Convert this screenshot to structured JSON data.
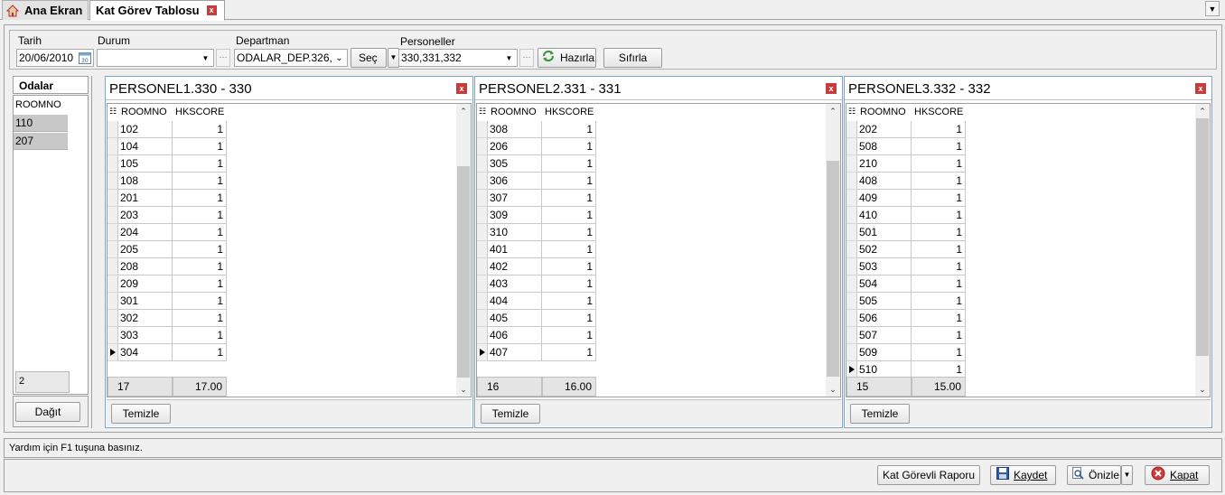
{
  "tabs": {
    "home_label": "Ana Ekran",
    "active_label": "Kat Görev Tablosu",
    "close_glyph": "x",
    "dropdown_glyph": "▼"
  },
  "filters": {
    "tarih_label": "Tarih",
    "tarih_value": "20/06/2010",
    "durum_label": "Durum",
    "durum_value": "",
    "departman_label": "Departman",
    "departman_value": "ODALAR_DEP.326,",
    "sec_button": "Seç",
    "personeller_label": "Personeller",
    "personeller_value": "330,331,332",
    "hazirla_button": "Hazırla",
    "sifirla_button": "Sıfırla",
    "ellipsis": "···"
  },
  "odalar": {
    "title": "Odalar",
    "column": "ROOMNO",
    "rows": [
      "110",
      "207"
    ],
    "count": "2",
    "dagit_button": "Dağıt"
  },
  "personel_panels": [
    {
      "title": "PERSONEL1.330 - 330",
      "col1": "ROOMNO",
      "col2": "HKSCORE",
      "rows": [
        [
          "102",
          "1"
        ],
        [
          "104",
          "1"
        ],
        [
          "105",
          "1"
        ],
        [
          "108",
          "1"
        ],
        [
          "201",
          "1"
        ],
        [
          "203",
          "1"
        ],
        [
          "204",
          "1"
        ],
        [
          "205",
          "1"
        ],
        [
          "208",
          "1"
        ],
        [
          "209",
          "1"
        ],
        [
          "301",
          "1"
        ],
        [
          "302",
          "1"
        ],
        [
          "303",
          "1"
        ],
        [
          "304",
          "1"
        ]
      ],
      "current_row": 13,
      "footer_count": "17",
      "footer_sum": "17.00",
      "scroll_thumb_top_fraction": 0.18,
      "scroll_thumb_size_fraction": 0.8,
      "temizle_button": "Temizle"
    },
    {
      "title": "PERSONEL2.331 - 331",
      "col1": "ROOMNO",
      "col2": "HKSCORE",
      "rows": [
        [
          "308",
          "1"
        ],
        [
          "206",
          "1"
        ],
        [
          "305",
          "1"
        ],
        [
          "306",
          "1"
        ],
        [
          "307",
          "1"
        ],
        [
          "309",
          "1"
        ],
        [
          "310",
          "1"
        ],
        [
          "401",
          "1"
        ],
        [
          "402",
          "1"
        ],
        [
          "403",
          "1"
        ],
        [
          "404",
          "1"
        ],
        [
          "405",
          "1"
        ],
        [
          "406",
          "1"
        ],
        [
          "407",
          "1"
        ]
      ],
      "current_row": 13,
      "footer_count": "16",
      "footer_sum": "16.00",
      "scroll_thumb_top_fraction": 0.16,
      "scroll_thumb_size_fraction": 0.82,
      "temizle_button": "Temizle"
    },
    {
      "title": "PERSONEL3.332 - 332",
      "col1": "ROOMNO",
      "col2": "HKSCORE",
      "rows": [
        [
          "202",
          "1"
        ],
        [
          "508",
          "1"
        ],
        [
          "210",
          "1"
        ],
        [
          "408",
          "1"
        ],
        [
          "409",
          "1"
        ],
        [
          "410",
          "1"
        ],
        [
          "501",
          "1"
        ],
        [
          "502",
          "1"
        ],
        [
          "503",
          "1"
        ],
        [
          "504",
          "1"
        ],
        [
          "505",
          "1"
        ],
        [
          "506",
          "1"
        ],
        [
          "507",
          "1"
        ],
        [
          "509",
          "1"
        ],
        [
          "510",
          "1"
        ]
      ],
      "current_row": 14,
      "footer_count": "15",
      "footer_sum": "15.00",
      "scroll_thumb_top_fraction": 0.0,
      "scroll_thumb_size_fraction": 0.9,
      "temizle_button": "Temizle"
    }
  ],
  "status": {
    "text": "Yardım için F1 tuşuna basınız."
  },
  "bottom": {
    "rapor_button": "Kat Görevli Raporu",
    "kaydet_button": "Kaydet",
    "onizle_button": "Önizle",
    "kapat_button": "Kapat"
  },
  "colors": {
    "panel_border": "#7fa6c9",
    "close_red": "#c83c3c",
    "selected_row": "#c8c8c8"
  }
}
